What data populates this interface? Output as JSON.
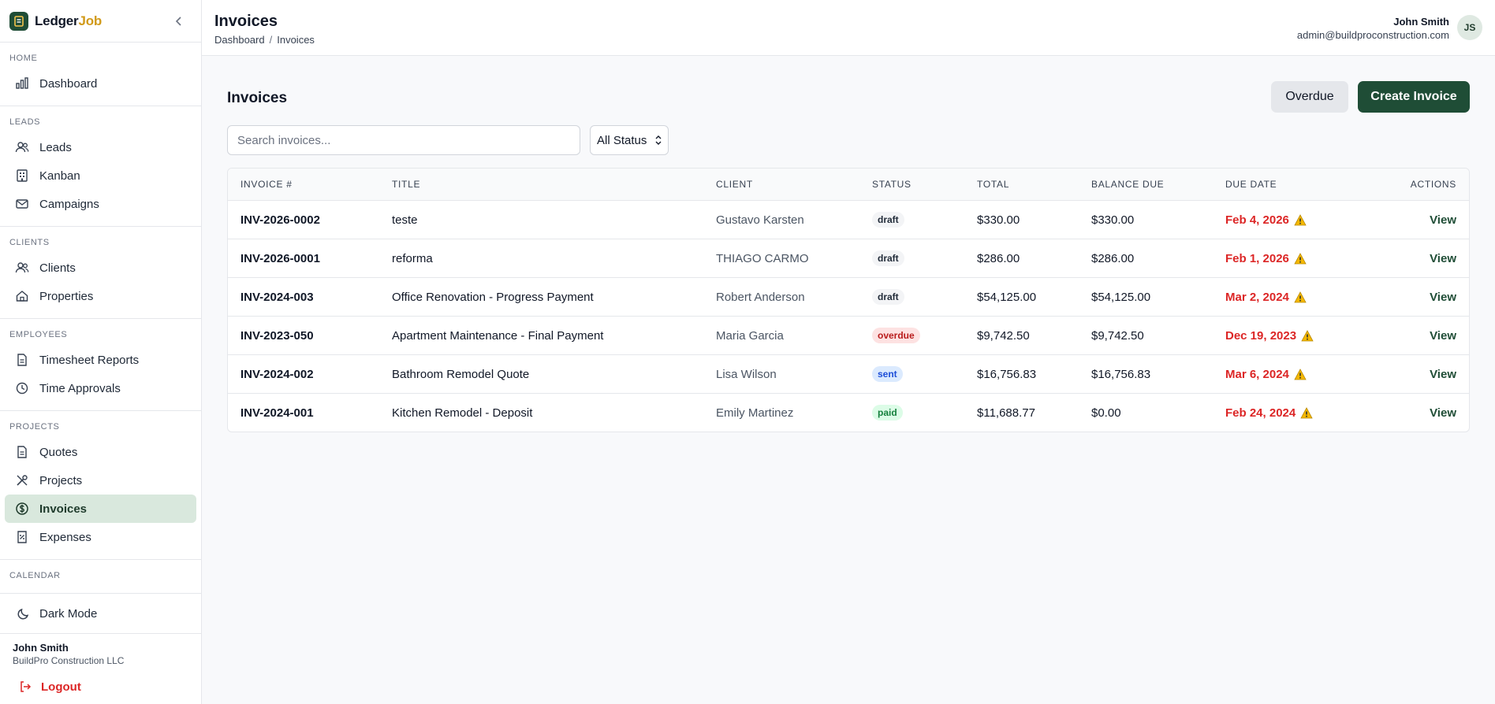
{
  "brand": {
    "name_part1": "Ledger",
    "name_part2": "Job"
  },
  "sidebar": {
    "sections": [
      {
        "label": "HOME",
        "items": [
          {
            "label": "Dashboard",
            "icon": "chart-icon"
          }
        ]
      },
      {
        "label": "LEADS",
        "items": [
          {
            "label": "Leads",
            "icon": "users-icon"
          },
          {
            "label": "Kanban",
            "icon": "building-icon"
          },
          {
            "label": "Campaigns",
            "icon": "mail-icon"
          }
        ]
      },
      {
        "label": "CLIENTS",
        "items": [
          {
            "label": "Clients",
            "icon": "users-icon"
          },
          {
            "label": "Properties",
            "icon": "home-icon"
          }
        ]
      },
      {
        "label": "EMPLOYEES",
        "items": [
          {
            "label": "Timesheet Reports",
            "icon": "file-icon"
          },
          {
            "label": "Time Approvals",
            "icon": "clock-icon"
          }
        ]
      },
      {
        "label": "PROJECTS",
        "items": [
          {
            "label": "Quotes",
            "icon": "file-icon"
          },
          {
            "label": "Projects",
            "icon": "tools-icon"
          },
          {
            "label": "Invoices",
            "icon": "dollar-icon",
            "active": true
          },
          {
            "label": "Expenses",
            "icon": "receipt-icon"
          }
        ]
      },
      {
        "label": "CALENDAR",
        "items": []
      }
    ],
    "dark_mode_label": "Dark Mode",
    "user_name": "John Smith",
    "user_company": "BuildPro Construction LLC",
    "logout_label": "Logout"
  },
  "header": {
    "title": "Invoices",
    "breadcrumb": [
      "Dashboard",
      "Invoices"
    ],
    "user_name": "John Smith",
    "user_email": "admin@buildproconstruction.com",
    "avatar_initials": "JS"
  },
  "main": {
    "title": "Invoices",
    "overdue_button": "Overdue",
    "create_button": "Create Invoice",
    "search_placeholder": "Search invoices...",
    "status_filter": "All Status"
  },
  "table": {
    "headers": [
      "INVOICE #",
      "TITLE",
      "CLIENT",
      "STATUS",
      "TOTAL",
      "BALANCE DUE",
      "DUE DATE",
      "ACTIONS"
    ],
    "rows": [
      {
        "number": "INV-2026-0002",
        "title": "teste",
        "client": "Gustavo Karsten",
        "status": "draft",
        "total": "$330.00",
        "balance": "$330.00",
        "due": "Feb 4, 2026",
        "action": "View"
      },
      {
        "number": "INV-2026-0001",
        "title": "reforma",
        "client": "THIAGO CARMO",
        "status": "draft",
        "total": "$286.00",
        "balance": "$286.00",
        "due": "Feb 1, 2026",
        "action": "View"
      },
      {
        "number": "INV-2024-003",
        "title": "Office Renovation - Progress Payment",
        "client": "Robert Anderson",
        "status": "draft",
        "total": "$54,125.00",
        "balance": "$54,125.00",
        "due": "Mar 2, 2024",
        "action": "View"
      },
      {
        "number": "INV-2023-050",
        "title": "Apartment Maintenance - Final Payment",
        "client": "Maria Garcia",
        "status": "overdue",
        "total": "$9,742.50",
        "balance": "$9,742.50",
        "due": "Dec 19, 2023",
        "action": "View"
      },
      {
        "number": "INV-2024-002",
        "title": "Bathroom Remodel Quote",
        "client": "Lisa Wilson",
        "status": "sent",
        "total": "$16,756.83",
        "balance": "$16,756.83",
        "due": "Mar 6, 2024",
        "action": "View"
      },
      {
        "number": "INV-2024-001",
        "title": "Kitchen Remodel - Deposit",
        "client": "Emily Martinez",
        "status": "paid",
        "total": "$11,688.77",
        "balance": "$0.00",
        "due": "Feb 24, 2024",
        "action": "View"
      }
    ]
  },
  "colors": {
    "brand": "#1f4d36",
    "accent": "#d19a1a",
    "danger": "#dc2626",
    "active_bg": "#d9e8dd"
  }
}
